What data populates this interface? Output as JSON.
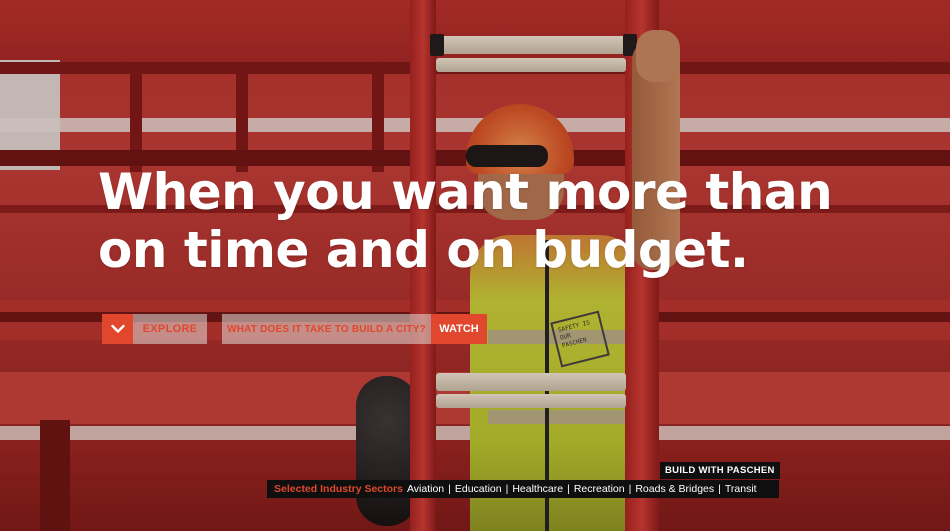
{
  "hero": {
    "headline_line1": "When you want more than",
    "headline_line2": "on time and on budget."
  },
  "cta": {
    "explore_icon": "chevron-down-icon",
    "explore_label": "EXPLORE",
    "watch_question": "WHAT DOES IT TAKE TO BUILD A CITY?",
    "watch_label": "WATCH"
  },
  "footer": {
    "build_tag": "BUILD WITH PASCHEN",
    "sectors_label": "Selected Industry Sectors",
    "sectors": [
      "Aviation",
      "Education",
      "Healthcare",
      "Recreation",
      "Roads & Bridges",
      "Transit"
    ],
    "separator": "|"
  },
  "background": {
    "vest_text": "SAFETY IS OUR PASCHEN"
  },
  "colors": {
    "accent": "#e0472c",
    "headline": "#ffffff",
    "footer_bg": "#0f0f0f",
    "button_bg": "#e1dcd7"
  }
}
